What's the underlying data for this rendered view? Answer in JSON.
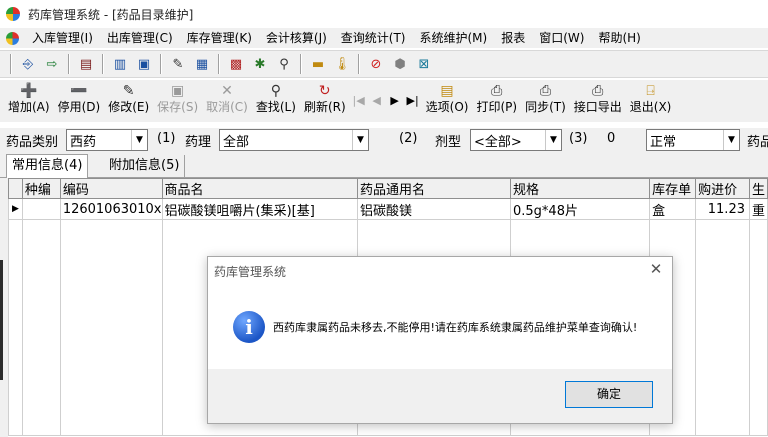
{
  "window": {
    "title": "药库管理系统 - [药品目录维护]"
  },
  "menu": [
    "入库管理(I)",
    "出库管理(C)",
    "库存管理(K)",
    "会计核算(J)",
    "查询统计(T)",
    "系统维护(M)",
    "报表",
    "窗口(W)",
    "帮助(H)"
  ],
  "toolbar1_icons": [
    {
      "name": "login-icon",
      "glyph": "⎆",
      "color": "#1a4fa0"
    },
    {
      "name": "logout-icon",
      "glyph": "⇨",
      "color": "#1a7a30"
    },
    {
      "name": "book-icon",
      "glyph": "▤",
      "color": "#7a1a1a"
    },
    {
      "name": "document-icon",
      "glyph": "▥",
      "color": "#1a4fa0"
    },
    {
      "name": "image-icon",
      "glyph": "▣",
      "color": "#1a4fa0"
    },
    {
      "name": "edit-doc-icon",
      "glyph": "✎",
      "color": "#333333"
    },
    {
      "name": "table-icon",
      "glyph": "▦",
      "color": "#1a4fa0"
    },
    {
      "name": "calculator-icon",
      "glyph": "▩",
      "color": "#b02020"
    },
    {
      "name": "tools-icon",
      "glyph": "✱",
      "color": "#2a7a2a"
    },
    {
      "name": "search-icon",
      "glyph": "⚲",
      "color": "#333333"
    },
    {
      "name": "folder-icon",
      "glyph": "▬",
      "color": "#c08a10"
    },
    {
      "name": "thermometer-icon",
      "glyph": "🌡",
      "color": "#c08a10"
    },
    {
      "name": "stop-icon",
      "glyph": "⊘",
      "color": "#d02020"
    },
    {
      "name": "cloud-icon",
      "glyph": "⬢",
      "color": "#808080"
    },
    {
      "name": "exit-box-icon",
      "glyph": "⊠",
      "color": "#1a7a9a"
    }
  ],
  "toolbar2": {
    "add": "增加(A)",
    "disable": "停用(D)",
    "modify": "修改(E)",
    "save": "保存(S)",
    "cancel": "取消(C)",
    "find": "查找(L)",
    "refresh": "刷新(R)",
    "options": "选项(O)",
    "print": "打印(P)",
    "sync": "同步(T)",
    "export": "接口导出",
    "exit": "退出(X)"
  },
  "filter": {
    "category_label": "药品类别",
    "category_value": "西药",
    "hint1": "(1)",
    "pharm_label": "药理",
    "pharm_value": "全部",
    "hint2": "(2)",
    "dosage_label": "剂型",
    "dosage_value": "<全部>",
    "hint3": "(3)",
    "zero": "0",
    "status_value": "正常",
    "drug_label": "药品"
  },
  "tabs": {
    "common": "常用信息(4)",
    "extra": "附加信息(5)"
  },
  "grid": {
    "columns": [
      "种编",
      "编码",
      "商品名",
      "药品通用名",
      "规格",
      "库存单",
      "购进价",
      "生"
    ],
    "rows": [
      [
        "",
        "12601063010x",
        "铝碳酸镁咀嚼片(集采)[基]",
        "铝碳酸镁",
        "0.5g*48片",
        "盒",
        "11.23",
        "重"
      ]
    ]
  },
  "dialog": {
    "title": "药库管理系统",
    "message": "西药库隶属药品未移去,不能停用!请在药库系统隶属药品维护菜单查询确认!",
    "ok": "确定"
  }
}
